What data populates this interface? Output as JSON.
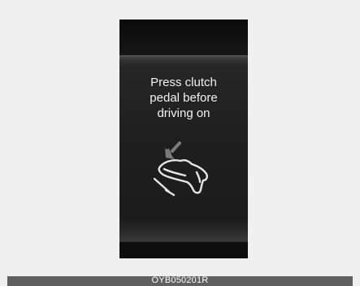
{
  "message": {
    "line1": "Press clutch",
    "line2": "pedal before",
    "line3": "driving on"
  },
  "icon": {
    "name": "clutch-pedal-foot-icon",
    "color": "#e6e6e6",
    "arrow_color": "#7a7a7a"
  },
  "caption": {
    "code": "OYB050201R"
  },
  "colors": {
    "page_background": "#f0f0f0",
    "cluster_background": "#111111",
    "caption_background": "#5f5f5f",
    "text": "#f2f2f2"
  }
}
